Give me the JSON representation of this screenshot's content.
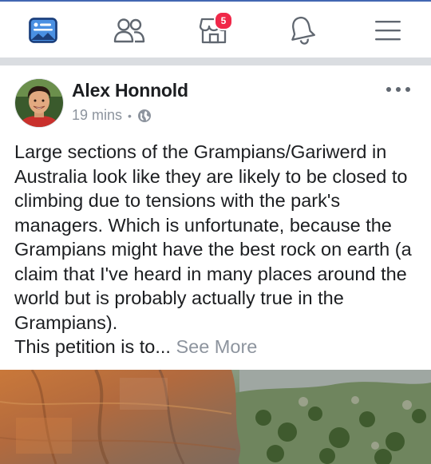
{
  "nav": {
    "items": [
      {
        "name": "news-feed",
        "icon": "news-feed-icon"
      },
      {
        "name": "friends",
        "icon": "friends-icon"
      },
      {
        "name": "marketplace",
        "icon": "marketplace-icon",
        "badge": "5"
      },
      {
        "name": "notifications",
        "icon": "bell-icon"
      },
      {
        "name": "menu",
        "icon": "hamburger-icon"
      }
    ],
    "accent_color": "#4267b2",
    "badge_color": "#f02849"
  },
  "post": {
    "author": "Alex Honnold",
    "time": "19 mins",
    "separator": "•",
    "privacy_icon": "globe-icon",
    "more_icon": "ellipsis-icon",
    "body": "Large sections of the Grampians/Gariwerd in Australia look like they are likely to be closed to climbing due to tensions with the park's managers. Which is unfortunate, because the Grampians might have the best rock on earth (a claim that I've heard in many places around the world but is probably actually true in the Grampians).",
    "body_continued": "This petition is to...",
    "see_more": "See More"
  }
}
